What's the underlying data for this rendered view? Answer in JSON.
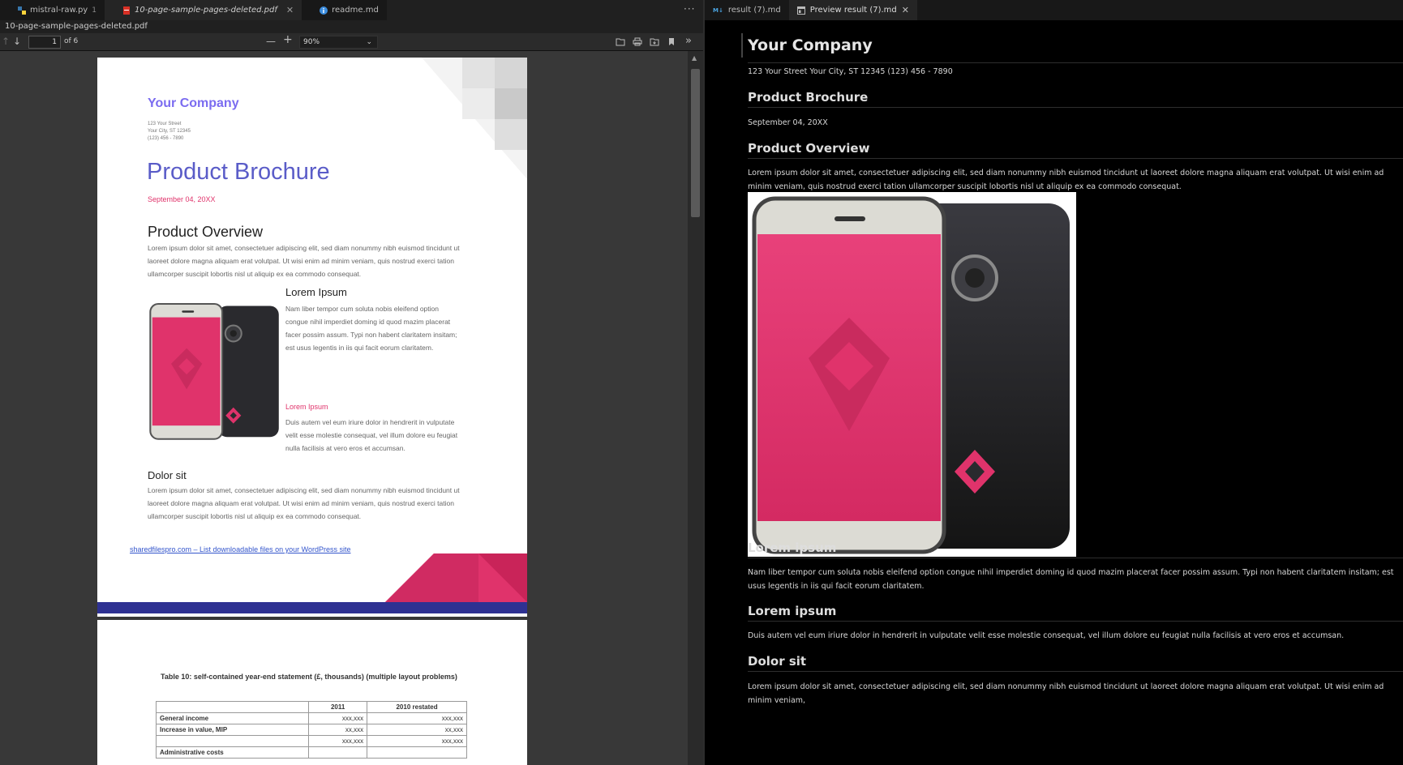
{
  "left_tabs": [
    {
      "label": "mistral-raw.py",
      "badge": "1"
    },
    {
      "label": "10-page-sample-pages-deleted.pdf"
    },
    {
      "label": "readme.md"
    }
  ],
  "breadcrumb": "10-page-sample-pages-deleted.pdf",
  "pdf_toolbar": {
    "page_value": "1",
    "page_of": "of 6",
    "zoom": "90%"
  },
  "pdf_page1": {
    "company": "Your Company",
    "address": "123 Your Street\nYour City, ST 12345\n(123) 456 - 7890",
    "title": "Product Brochure",
    "date": "September 04, 20XX",
    "overview_heading": "Product Overview",
    "overview_text": "Lorem ipsum dolor sit amet, consectetuer adipiscing elit, sed diam nonummy nibh euismod tincidunt ut laoreet dolore magna aliquam erat volutpat. Ut wisi enim ad minim veniam, quis nostrud exerci tation ullamcorper suscipit lobortis nisl ut aliquip ex ea commodo consequat.",
    "lorem_heading": "Lorem Ipsum",
    "lorem_text": "Nam liber tempor cum soluta nobis eleifend option congue nihil imperdiet doming id quod mazim placerat facer possim assum. Typi non habent claritatem insitam; est usus legentis in iis qui facit eorum claritatem.",
    "lorem_sub": "Lorem Ipsum",
    "lorem_sub_text": "Duis autem vel eum iriure dolor in hendrerit in vulputate velit esse molestie consequat, vel illum dolore eu feugiat nulla facilisis at vero eros et accumsan.",
    "dolor_heading": "Dolor sit",
    "dolor_text": "Lorem ipsum dolor sit amet, consectetuer adipiscing elit, sed diam nonummy nibh euismod tincidunt ut laoreet dolore magna aliquam erat volutpat. Ut wisi enim ad minim veniam, quis nostrud exerci tation ullamcorper suscipit lobortis nisl ut aliquip ex ea commodo consequat.",
    "link": "sharedfilespro.com – List downloadable files on your WordPress site"
  },
  "pdf_page2": {
    "table_title": "Table 10: self-contained year-end statement (£, thousands) (multiple layout problems)",
    "columns": [
      "",
      "2011",
      "2010 restated"
    ],
    "rows": [
      [
        "General income",
        "xxx,xxx",
        "xxx,xxx"
      ],
      [
        "Increase in value, MIP",
        "xx,xxx",
        "xx,xxx"
      ],
      [
        "",
        "xxx,xxx",
        "xxx,xxx"
      ],
      [
        "Administrative costs",
        "",
        ""
      ]
    ]
  },
  "right_tabs": [
    {
      "label": "result (7).md",
      "badge": "M↓"
    },
    {
      "label": "Preview result (7).md"
    }
  ],
  "preview": {
    "h1": "Your Company",
    "address_line": "123 Your Street Your City, ST 12345 (123) 456 - 7890",
    "h2_brochure": "Product Brochure",
    "date": "September 04, 20XX",
    "h2_overview": "Product Overview",
    "overview_text": "Lorem ipsum dolor sit amet, consectetuer adipiscing elit, sed diam nonummy nibh euismod tincidunt ut laoreet dolore magna aliquam erat volutpat. Ut wisi enim ad minim veniam, quis nostrud exerci tation ullamcorper suscipit lobortis nisl ut aliquip ex ea commodo consequat.",
    "h2_lorem1": "Lorem ipsum",
    "lorem1_text": "Nam liber tempor cum soluta nobis eleifend option congue nihil imperdiet doming id quod mazim placerat facer possim assum. Typi non habent claritatem insitam; est usus legentis in iis qui facit eorum claritatem.",
    "h2_lorem2": "Lorem ipsum",
    "lorem2_text": "Duis autem vel eum iriure dolor in hendrerit in vulputate velit esse molestie consequat, vel illum dolore eu feugiat nulla facilisis at vero eros et accumsan.",
    "h2_dolor": "Dolor sit",
    "dolor_text": "Lorem ipsum dolor sit amet, consectetuer adipiscing elit, sed diam nonummy nibh euismod tincidunt ut laoreet dolore magna aliquam erat volutpat. Ut wisi enim ad minim veniam,"
  },
  "colors": {
    "accent_pink": "#e0336b",
    "brand_purple": "#7b6cf0",
    "title_blue": "#5a5cc8",
    "band_navy": "#2e3192"
  }
}
